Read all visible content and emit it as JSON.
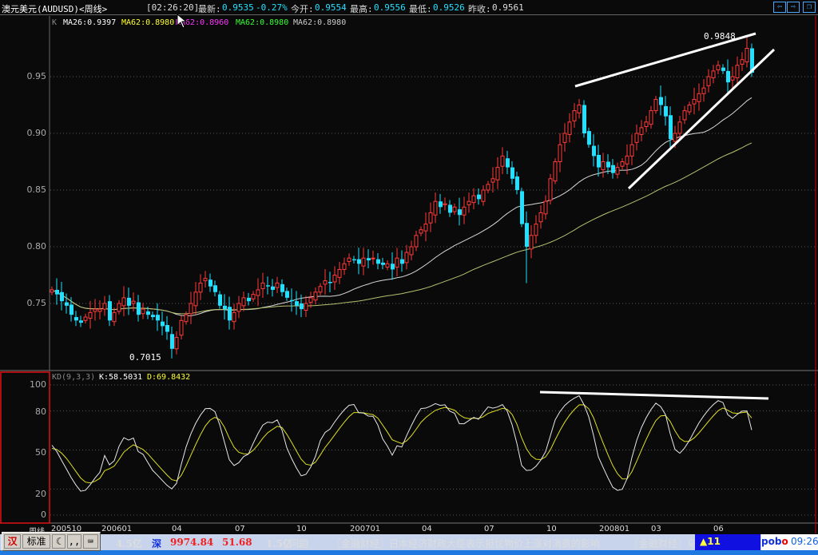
{
  "header": {
    "title": "澳元美元(AUDUSD)<周线>",
    "time": "[02:26:20]",
    "latest_label": "最新:",
    "latest": "0.9535",
    "change": "-0.27%",
    "open_label": "今开:",
    "open": "0.9554",
    "high_label": "最高:",
    "high": "0.9556",
    "low_label": "最低:",
    "low": "0.9526",
    "prev_label": "昨收:",
    "prev": "0.9561"
  },
  "window_buttons": {
    "back": "⇦",
    "forward": "⇨",
    "restore": "❐"
  },
  "price_panel": {
    "k_label": "K",
    "ma_legend": [
      "MA26:0.9397",
      "MA62:0.8980",
      "MA62:0.8960",
      "MA62:0.8980",
      "MA62:0.8980"
    ],
    "ma_colors": [
      "#ffffff",
      "#ffff33",
      "#ff33ff",
      "#33ff33",
      "#cccccc"
    ],
    "axis_ticks": [
      "0.95",
      "0.90",
      "0.85",
      "0.80",
      "0.75"
    ],
    "low_annotation": "0.7015",
    "high_annotation": "0.9848"
  },
  "kd_panel": {
    "title": "KD(9,3,3)",
    "k": "K:58.5031",
    "d": "D:69.8432",
    "axis_ticks": [
      "100",
      "80",
      "50",
      "20",
      "0"
    ]
  },
  "x_axis": {
    "period_label": "周线",
    "labels": [
      "200510",
      "200601",
      "04",
      "07",
      "10",
      "200701",
      "04",
      "07",
      "10",
      "200801",
      "03",
      "06"
    ]
  },
  "chart_data": {
    "type": "candlestick",
    "title": "澳元美元(AUDUSD) 周线",
    "ylim": [
      0.69,
      0.99
    ],
    "up_color": "#ff3b3b",
    "down_color": "#22e0ff",
    "close": [
      0.762,
      0.758,
      0.752,
      0.748,
      0.74,
      0.735,
      0.733,
      0.738,
      0.742,
      0.745,
      0.745,
      0.75,
      0.735,
      0.742,
      0.75,
      0.755,
      0.748,
      0.752,
      0.74,
      0.745,
      0.74,
      0.738,
      0.735,
      0.73,
      0.725,
      0.71,
      0.72,
      0.735,
      0.74,
      0.75,
      0.76,
      0.768,
      0.772,
      0.765,
      0.76,
      0.748,
      0.745,
      0.735,
      0.742,
      0.75,
      0.755,
      0.752,
      0.758,
      0.762,
      0.768,
      0.765,
      0.762,
      0.768,
      0.76,
      0.755,
      0.752,
      0.748,
      0.745,
      0.75,
      0.755,
      0.76,
      0.765,
      0.77,
      0.768,
      0.775,
      0.78,
      0.785,
      0.79,
      0.788,
      0.785,
      0.79,
      0.788,
      0.79,
      0.785,
      0.784,
      0.785,
      0.78,
      0.79,
      0.785,
      0.795,
      0.8,
      0.81,
      0.815,
      0.82,
      0.83,
      0.84,
      0.835,
      0.838,
      0.83,
      0.835,
      0.828,
      0.835,
      0.84,
      0.845,
      0.842,
      0.85,
      0.855,
      0.86,
      0.87,
      0.88,
      0.87,
      0.86,
      0.85,
      0.82,
      0.8,
      0.81,
      0.82,
      0.83,
      0.84,
      0.86,
      0.875,
      0.89,
      0.9,
      0.91,
      0.92,
      0.925,
      0.9,
      0.89,
      0.88,
      0.87,
      0.875,
      0.87,
      0.865,
      0.87,
      0.875,
      0.88,
      0.89,
      0.9,
      0.905,
      0.91,
      0.92,
      0.93,
      0.925,
      0.915,
      0.895,
      0.9,
      0.91,
      0.92,
      0.925,
      0.93,
      0.935,
      0.94,
      0.95,
      0.955,
      0.96,
      0.955,
      0.945,
      0.95,
      0.96,
      0.965,
      0.975,
      0.9535
    ],
    "period_low": 0.7015,
    "period_high": 0.9848
  },
  "status": {
    "vol1": "4.5亿",
    "sz": "深",
    "index": "9974.84",
    "change": "51.68",
    "vol2": "1.5亿",
    "news_tail": "问题",
    "news1": "〖金融财经〗日本经济财政大臣表示担忧物价上涨对消费的影响",
    "news2": "〖金融财经〗马来",
    "alert": "▲11",
    "brand_a": "pob",
    "brand_b": "o",
    "clock": "09:26"
  },
  "ime": {
    "mode": "标准"
  }
}
